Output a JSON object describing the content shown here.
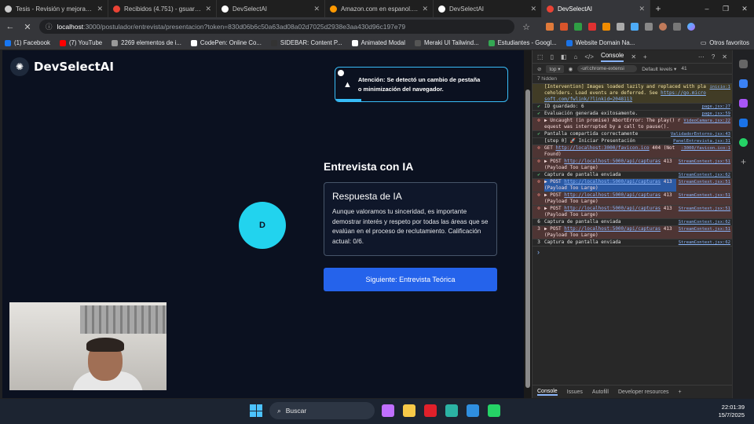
{
  "browser": {
    "tabs": [
      {
        "title": "Tesis - Revisión y mejoras ba",
        "color": "#cccccc"
      },
      {
        "title": "Recibidos (4.751) - gsuareza3",
        "color": "#ea4335"
      },
      {
        "title": "DevSelectAI",
        "color": "#ffffff"
      },
      {
        "title": "Amazon.com en espanol. Gar",
        "color": "#ff9900"
      },
      {
        "title": "DevSelectAI",
        "color": "#ffffff"
      },
      {
        "title": "DevSelectAI",
        "color": "#ea4335",
        "active": true
      }
    ],
    "new_tab": "+",
    "window_controls": {
      "minimize": "–",
      "maximize": "❐",
      "close": "✕"
    },
    "url_host": "localhost",
    "url_path": ":3000/postulador/entrevista/presentacion?token=830d06b6c50a63ad08a02d7025d2938e3aa430d96c197e79",
    "bookmarks": [
      {
        "label": "(1) Facebook",
        "color": "#1877f2"
      },
      {
        "label": "(7) YouTube",
        "color": "#ff0000"
      },
      {
        "label": "2269 elementos de i...",
        "color": "#999999"
      },
      {
        "label": "CodePen: Online Co...",
        "color": "#ffffff"
      },
      {
        "label": "SIDEBAR: Content P...",
        "color": "#333333"
      },
      {
        "label": "Animated Modal",
        "color": "#ffffff"
      },
      {
        "label": "Meraki UI Tailwind...",
        "color": "#555555"
      },
      {
        "label": "Estudiantes - Googl...",
        "color": "#34a853"
      },
      {
        "label": "Website Domain Na...",
        "color": "#1a73e8"
      }
    ],
    "other_bookmarks": "Otros favoritos"
  },
  "app": {
    "logo_text": "DevSelectAI",
    "alert_text_line1": "Atención: Se detectó un cambio de pestaña",
    "alert_text_line2": "o minimización del navegador.",
    "alert_progress": 0.15,
    "avatar_letter": "D",
    "interview_title": "Entrevista con IA",
    "response_title": "Respuesta de IA",
    "response_text": "Aunque valoramos tu sinceridad, es importante demostrar interés y respeto por todas las áreas que se evalúan en el proceso de reclutamiento. Calificación actual: 0/6.",
    "next_button": "Siguiente: Entrevista Teórica"
  },
  "devtools": {
    "console_tab": "Console",
    "context": "top ▾",
    "filter": "-url:chrome-extensi",
    "levels": "Default levels ▾",
    "issues_count": "41",
    "hidden": "7 hidden",
    "logs": [
      {
        "type": "warn",
        "msg": "[Intervention] Images loaded lazily and replaced with placeholders. Load events are deferred. See ",
        "link": "https://go.microsoft.com/fwlink/?linkid=2048113",
        "src": "inicio:1"
      },
      {
        "type": "info",
        "icon": "✔",
        "msg": "ID guardado: 6",
        "src": "page.jsx:27"
      },
      {
        "type": "info",
        "icon": "✔",
        "msg": "Evaluación generada exitosamente.",
        "src": "page.jsx:59"
      },
      {
        "type": "err",
        "msg": "▶ Uncaught (in promise) AbortError: The play() request was interrupted by a call to pause().",
        "src": "VideoCamara.jsx:22"
      },
      {
        "type": "info",
        "icon": "✔",
        "msg": "Pantalla compartida correctamente",
        "src": "ValidadorEntorno.jsx:43"
      },
      {
        "type": "info",
        "icon": "",
        "msg": "[step 0] 🚀 Iniciar Presentación",
        "src": "PanelEntrevista.jsx:31"
      },
      {
        "type": "err",
        "msg": "GET ",
        "link": "http://localhost:3000/favicon.ico",
        "tail": " 404 (Not Found)",
        "src": ":3000/favicon.ico:1"
      },
      {
        "type": "err",
        "msg": "▶ POST ",
        "link": "http://localhost:5000/api/capturas",
        "tail": " 413 (Payload Too Large)",
        "src": "StreamContext.jsx:51"
      },
      {
        "type": "info",
        "icon": "✔",
        "msg": "Captura de pantalla enviada",
        "src": "StreamContext.jsx:62"
      },
      {
        "type": "err",
        "sel": true,
        "msg": "▶ POST ",
        "link": "http://localhost:5000/api/capturas",
        "tail": " 413 (Payload Too Large)",
        "src": "StreamContext.jsx:51"
      },
      {
        "type": "err",
        "msg": "▶ POST ",
        "link": "http://localhost:5000/api/capturas",
        "tail": " 413 (Payload Too Large)",
        "src": "StreamContext.jsx:51"
      },
      {
        "type": "err",
        "msg": "▶ POST ",
        "link": "http://localhost:5000/api/capturas",
        "tail": " 413 (Payload Too Large)",
        "src": "StreamContext.jsx:51"
      },
      {
        "type": "info",
        "icon": "✔",
        "count": "6",
        "msg": "Captura de pantalla enviada",
        "src": "StreamContext.jsx:62"
      },
      {
        "type": "err",
        "count": "3",
        "msg": "▶ POST ",
        "link": "http://localhost:5000/api/capturas",
        "tail": " 413 (Payload Too Large)",
        "src": "StreamContext.jsx:51"
      },
      {
        "type": "info",
        "icon": "✔",
        "count": "3",
        "msg": "Captura de pantalla enviada",
        "src": "StreamContext.jsx:62"
      }
    ],
    "bottom_tabs": [
      "Console",
      "Issues",
      "Autofill",
      "Developer resources"
    ]
  },
  "taskbar": {
    "search": "Buscar",
    "time": "22:01:39",
    "date": "15/7/2025",
    "apps": [
      {
        "name": "copilot-app",
        "color": "#c06fff"
      },
      {
        "name": "file-explorer-app",
        "color": "#f7c948"
      },
      {
        "name": "opera-app",
        "color": "#e0202a"
      },
      {
        "name": "edge-app",
        "color": "#2bb3a4"
      },
      {
        "name": "vscode-app",
        "color": "#2f8fe0"
      },
      {
        "name": "whatsapp-app",
        "color": "#25d366"
      }
    ]
  }
}
